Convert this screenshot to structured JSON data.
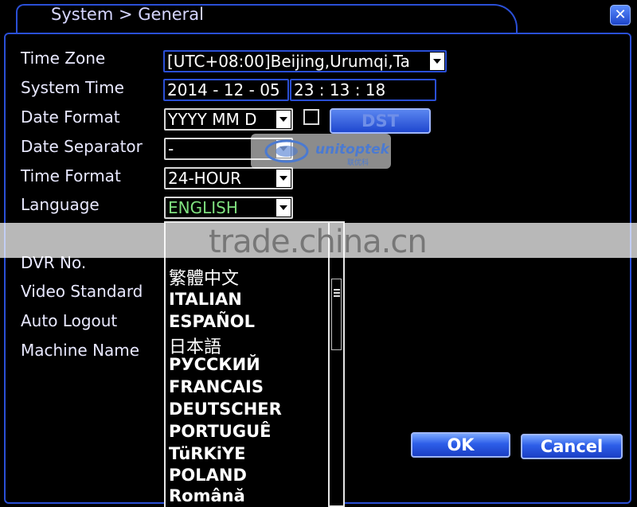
{
  "window": {
    "title": "System > General",
    "close_icon": "close-icon"
  },
  "form": {
    "time_zone": {
      "label": "Time Zone",
      "value": "[UTC+08:00]Beijing,Urumqi,Ta"
    },
    "system_time": {
      "label": "System Time",
      "date": "2014 - 12 - 05",
      "time": "23 : 13 : 18"
    },
    "date_format": {
      "label": "Date Format",
      "value": "YYYY MM D",
      "dst_label": "DST"
    },
    "date_separator": {
      "label": "Date Separator",
      "value": "-"
    },
    "time_format": {
      "label": "Time Format",
      "value": "24-HOUR"
    },
    "language": {
      "label": "Language",
      "value": "ENGLISH"
    },
    "dvr_no": {
      "label": "DVR No."
    },
    "video_standard": {
      "label": "Video Standard"
    },
    "auto_logout": {
      "label": "Auto Logout"
    },
    "machine_name": {
      "label": "Machine Name"
    }
  },
  "language_options": [
    "繁體中文",
    "ITALIAN",
    "ESPAÑOL",
    "日本語",
    "РУССКИЙ",
    "FRANCAIS",
    "DEUTSCHER",
    "PORTUGUÊ",
    "TüRKiYE",
    "POLAND",
    "Română"
  ],
  "buttons": {
    "ok": "OK",
    "cancel": "Cancel"
  },
  "watermark": {
    "text": "trade.china.cn",
    "logo_text": "unitoptek",
    "logo_sub": "联优科"
  },
  "colors": {
    "frame": "#2a4fd6",
    "button": "#2d5ee8",
    "language_value": "#7fe07f"
  }
}
